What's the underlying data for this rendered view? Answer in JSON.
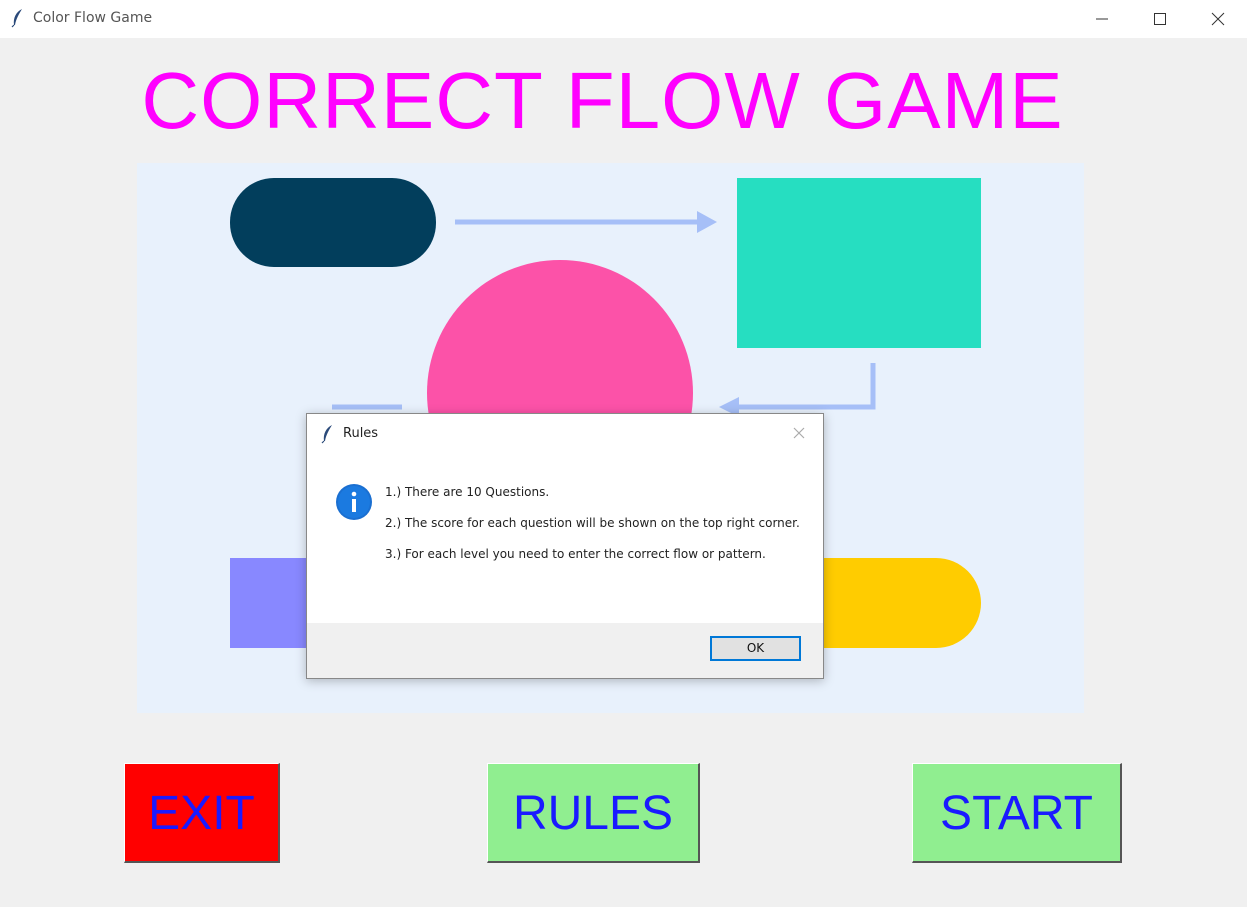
{
  "window": {
    "title": "Color Flow Game",
    "icon": "feather-icon"
  },
  "main": {
    "title": "CORRECT FLOW GAME",
    "title_color": "#ff00ff"
  },
  "diagram": {
    "colors": {
      "pill_top": "#023e5c",
      "rect_top": "#26dec1",
      "circle": "#fc52a8",
      "rect_bottom": "#8888ff",
      "pill_bottom": "#ffcc00",
      "arrows": "#a6bff7"
    }
  },
  "buttons": {
    "exit": "EXIT",
    "rules": "RULES",
    "start": "START",
    "label_color": "#1a1aff",
    "exit_color": "#ff0000",
    "green_color": "#90ee90"
  },
  "dialog": {
    "title": "Rules",
    "icon": "info-icon",
    "lines": [
      "1.) There are 10 Questions.",
      "2.) The score for each question will be shown on the top right corner.",
      "3.)  For each level you need to enter the correct flow or pattern."
    ],
    "ok_label": "OK"
  }
}
